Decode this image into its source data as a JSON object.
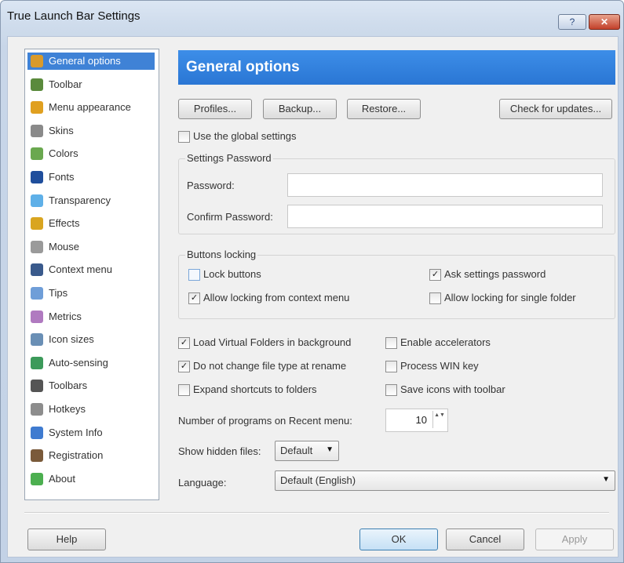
{
  "window": {
    "title": "True Launch Bar Settings",
    "help_glyph": "?",
    "close_glyph": "✕"
  },
  "sidebar": {
    "items": [
      {
        "label": "General options",
        "icon": "wrench-icon",
        "color": "#d99a2b",
        "selected": true
      },
      {
        "label": "Toolbar",
        "icon": "toolbar-icon",
        "color": "#5a8a3c"
      },
      {
        "label": "Menu appearance",
        "icon": "menu-icon",
        "color": "#e0a020"
      },
      {
        "label": "Skins",
        "icon": "skins-icon",
        "color": "#8a8a8a"
      },
      {
        "label": "Colors",
        "icon": "palette-icon",
        "color": "#6aa84f"
      },
      {
        "label": "Fonts",
        "icon": "font-icon",
        "color": "#1f4e9c"
      },
      {
        "label": "Transparency",
        "icon": "transparency-icon",
        "color": "#5fb0e8"
      },
      {
        "label": "Effects",
        "icon": "wand-icon",
        "color": "#d9a520"
      },
      {
        "label": "Mouse",
        "icon": "mouse-icon",
        "color": "#9a9a9a"
      },
      {
        "label": "Context menu",
        "icon": "context-menu-icon",
        "color": "#3a5a8c"
      },
      {
        "label": "Tips",
        "icon": "tip-bubble-icon",
        "color": "#6f9ed8"
      },
      {
        "label": "Metrics",
        "icon": "metrics-icon",
        "color": "#b07ac0"
      },
      {
        "label": "Icon sizes",
        "icon": "icon-sizes-icon",
        "color": "#6a8fb5"
      },
      {
        "label": "Auto-sensing",
        "icon": "auto-sensing-icon",
        "color": "#3c9a5a"
      },
      {
        "label": "Toolbars",
        "icon": "toolbars-icon",
        "color": "#555555"
      },
      {
        "label": "Hotkeys",
        "icon": "hotkeys-icon",
        "color": "#8d8d8d"
      },
      {
        "label": "System Info",
        "icon": "system-info-icon",
        "color": "#3f7bd0"
      },
      {
        "label": "Registration",
        "icon": "registration-icon",
        "color": "#7a5a3a"
      },
      {
        "label": "About",
        "icon": "about-icon",
        "color": "#4caf50"
      }
    ]
  },
  "main": {
    "header": "General options",
    "buttons": {
      "profiles": "Profiles...",
      "backup": "Backup...",
      "restore": "Restore...",
      "updates": "Check for updates..."
    },
    "use_global": {
      "label": "Use the global settings",
      "checked": false
    },
    "password_group": {
      "title": "Settings Password",
      "password_label": "Password:",
      "confirm_label": "Confirm Password:",
      "password_value": "",
      "confirm_value": ""
    },
    "locking_group": {
      "title": "Buttons locking",
      "lock_buttons": {
        "label": "Lock buttons",
        "checked": false
      },
      "ask_password": {
        "label": "Ask settings password",
        "checked": true
      },
      "allow_context": {
        "label": "Allow locking from context menu",
        "checked": true
      },
      "allow_single": {
        "label": "Allow locking for single folder",
        "checked": false
      }
    },
    "options": {
      "load_virtual": {
        "label": "Load Virtual Folders in background",
        "checked": true
      },
      "no_change_type": {
        "label": "Do not change file type at rename",
        "checked": true
      },
      "expand_shortcuts": {
        "label": "Expand shortcuts to folders",
        "checked": false
      },
      "enable_accel": {
        "label": "Enable accelerators",
        "checked": false
      },
      "process_win": {
        "label": "Process WIN key",
        "checked": false
      },
      "save_icons": {
        "label": "Save icons with toolbar",
        "checked": false
      }
    },
    "recent": {
      "label": "Number of programs on Recent menu:",
      "value": "10"
    },
    "hidden_files": {
      "label": "Show hidden files:",
      "value": "Default"
    },
    "language": {
      "label": "Language:",
      "value": "Default (English)"
    }
  },
  "footer": {
    "help": "Help",
    "ok": "OK",
    "cancel": "Cancel",
    "apply": "Apply"
  },
  "glyphs": {
    "check": "✓",
    "dropdown": "▼",
    "spin": "▲▼"
  }
}
